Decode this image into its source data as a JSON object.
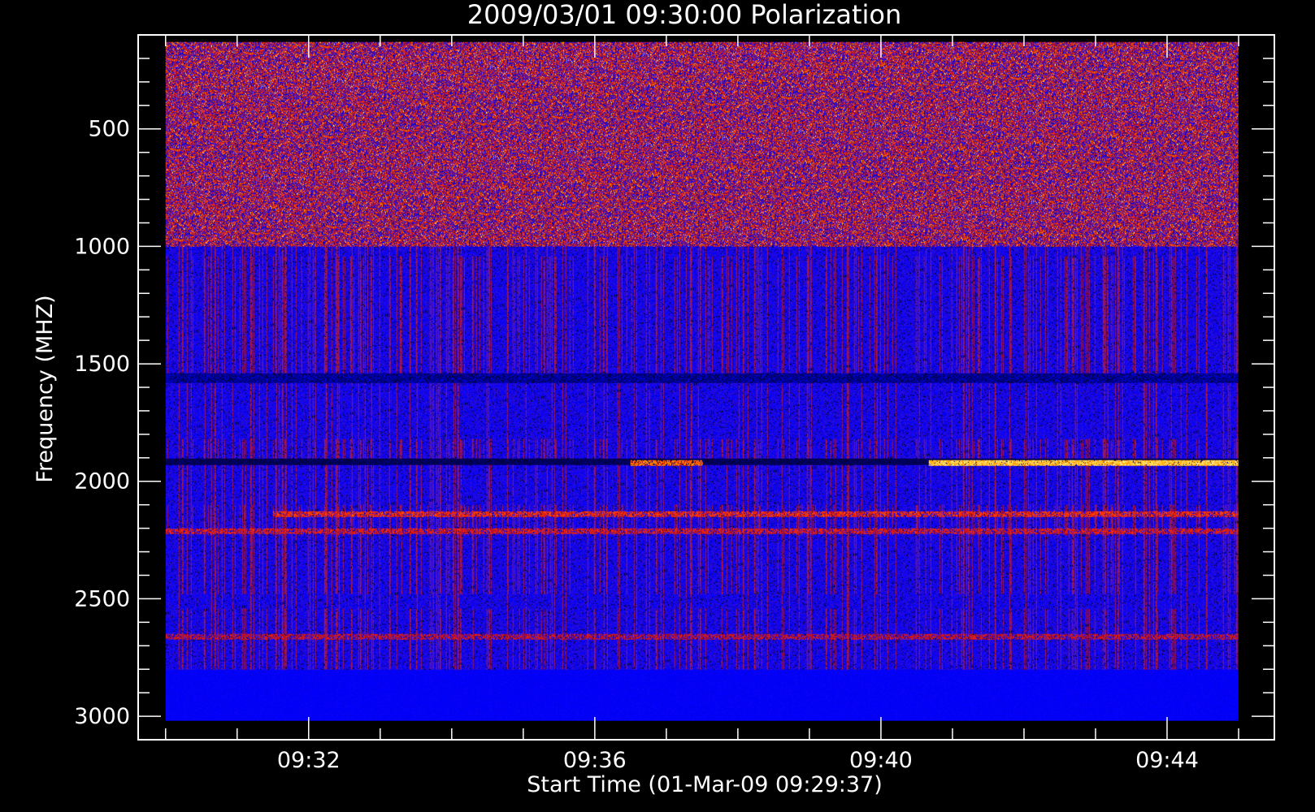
{
  "chart_data": {
    "type": "heatmap",
    "title": "2009/03/01 09:30:00 Polarization",
    "xlabel": "Start Time (01-Mar-09 09:29:37)",
    "ylabel": "Frequency (MHZ)",
    "xlim": [
      "09:29:37",
      "09:45:30"
    ],
    "ylim": [
      100,
      3100
    ],
    "y_inverted": true,
    "data_x_range": [
      "09:30:00",
      "09:45:00"
    ],
    "data_y_range": [
      130,
      3020
    ],
    "x_ticks": [
      "09:32",
      "09:36",
      "09:40",
      "09:44"
    ],
    "y_ticks": [
      "500",
      "1000",
      "1500",
      "2000",
      "2500",
      "3000"
    ],
    "colormap": [
      "#000010",
      "#0000ff",
      "#5a1aa8",
      "#b01030",
      "#ff2a00",
      "#ffb000",
      "#ffffb0"
    ],
    "bands": [
      {
        "freq": [
          130,
          330
        ],
        "type": "noise",
        "level": 0.72
      },
      {
        "freq": [
          330,
          1000
        ],
        "type": "noise",
        "level": 0.55
      },
      {
        "freq": [
          1000,
          1040
        ],
        "type": "streaks",
        "level": 0.25
      },
      {
        "freq": [
          1040,
          1540
        ],
        "type": "streaks",
        "level": 0.4
      },
      {
        "freq": [
          1540,
          1580
        ],
        "type": "dark",
        "level": 0.1
      },
      {
        "freq": [
          1580,
          1820
        ],
        "type": "streaks",
        "level": 0.18
      },
      {
        "freq": [
          1820,
          1900
        ],
        "type": "streaks",
        "level": 0.4
      },
      {
        "freq": [
          1900,
          1930
        ],
        "type": "line",
        "level": 0.1
      },
      {
        "freq": [
          1930,
          2100
        ],
        "type": "streaks",
        "level": 0.25
      },
      {
        "freq": [
          2100,
          2230
        ],
        "type": "streaks",
        "level": 0.45
      },
      {
        "freq": [
          2230,
          2480
        ],
        "type": "streaks",
        "level": 0.35
      },
      {
        "freq": [
          2480,
          2540
        ],
        "type": "streaks",
        "level": 0.15
      },
      {
        "freq": [
          2540,
          2800
        ],
        "type": "streaks",
        "level": 0.3
      },
      {
        "freq": [
          2800,
          3020
        ],
        "type": "flat",
        "level": 0.05
      }
    ],
    "emission_features": [
      {
        "freq": 1920,
        "time": [
          "09:40:40",
          "09:45:00"
        ],
        "level": 0.95
      },
      {
        "freq": 1920,
        "time": [
          "09:36:30",
          "09:37:30"
        ],
        "level": 0.8
      },
      {
        "freq": 2140,
        "time": [
          "09:31:30",
          "09:45:00"
        ],
        "level": 0.7
      },
      {
        "freq": 2210,
        "time": [
          "09:30:00",
          "09:45:00"
        ],
        "level": 0.65
      },
      {
        "freq": 2660,
        "time": [
          "09:30:00",
          "09:45:00"
        ],
        "level": 0.6
      }
    ]
  }
}
